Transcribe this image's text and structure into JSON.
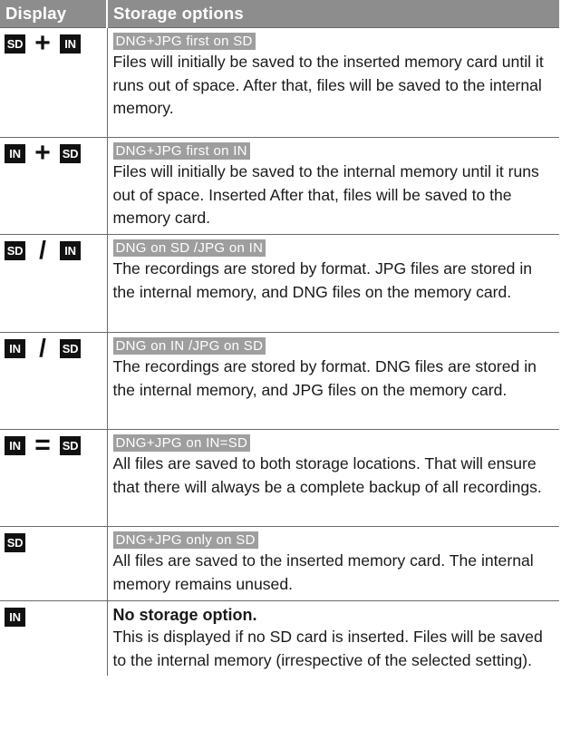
{
  "headers": {
    "display": "Display",
    "storage_options": "Storage options"
  },
  "rows": [
    {
      "icons": [
        "SD",
        "+",
        "IN"
      ],
      "option": "DNG+JPG first on SD",
      "description": "Files will initially be saved to the inserted memory card until it runs out of space. After that, files will be saved to the internal memory."
    },
    {
      "icons": [
        "IN",
        "+",
        "SD"
      ],
      "option": "DNG+JPG first on IN",
      "description": "Files will initially be saved to the internal memory until it runs out of space. Inserted After that, files will be saved to the memory card."
    },
    {
      "icons": [
        "SD",
        "/",
        "IN"
      ],
      "option": "DNG on SD /JPG on IN",
      "description": "The recordings are stored by format. JPG files are stored in the internal memory, and DNG files on the memory card."
    },
    {
      "icons": [
        "IN",
        "/",
        "SD"
      ],
      "option": "DNG on IN /JPG on SD",
      "description": "The recordings are stored by format. DNG files are stored in the internal memory, and JPG files on the memory card."
    },
    {
      "icons": [
        "IN",
        "=",
        "SD"
      ],
      "option": "DNG+JPG on IN=SD",
      "description": "All files are saved to both storage locations. That will ensure that there will always be a complete backup of all recordings."
    },
    {
      "icons": [
        "SD"
      ],
      "option": "DNG+JPG only on SD",
      "description": "All files are saved to the inserted memory card. The internal memory remains unused."
    },
    {
      "icons": [
        "IN"
      ],
      "option": "No storage option.",
      "description": "This is displayed if no SD card is inserted. Files will be saved to the internal memory (irrespective of the selected setting)."
    }
  ],
  "colors": {
    "header_bg": "#8d8d8d",
    "chip_bg": "#9e9e9e",
    "icon_bg": "#111111",
    "rule": "#6a6a6a"
  }
}
